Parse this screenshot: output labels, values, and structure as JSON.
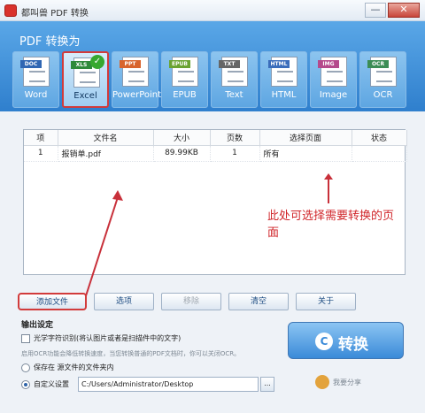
{
  "window": {
    "title": "都叫兽 PDF 转换",
    "minimize": "—",
    "close": "✕"
  },
  "banner": {
    "title": "PDF 转换为"
  },
  "formats": [
    {
      "label": "Word",
      "tag": "DOC",
      "color": "#2f66b3",
      "active": false
    },
    {
      "label": "Excel",
      "tag": "XLS",
      "color": "#2e8a3a",
      "active": true
    },
    {
      "label": "PowerPoint",
      "tag": "PPT",
      "color": "#d8642d",
      "active": false
    },
    {
      "label": "EPUB",
      "tag": "EPUB",
      "color": "#6aa332",
      "active": false
    },
    {
      "label": "Text",
      "tag": "TXT",
      "color": "#666666",
      "active": false
    },
    {
      "label": "HTML",
      "tag": "HTML",
      "color": "#3b6dbb",
      "active": false
    },
    {
      "label": "Image",
      "tag": "IMG",
      "color": "#b54a8c",
      "active": false
    },
    {
      "label": "OCR",
      "tag": "OCR",
      "color": "#3c8d55",
      "active": false
    }
  ],
  "table": {
    "headers": [
      "项",
      "文件名",
      "大小",
      "页数",
      "选择页面",
      "状态"
    ],
    "rows": [
      {
        "index": "1",
        "filename": "报销单.pdf",
        "size": "89.99KB",
        "pages": "1",
        "selected_pages": "所有",
        "status": ""
      }
    ]
  },
  "annotation": {
    "text": "此处可选择需要转换的页面",
    "color": "#d0262a"
  },
  "buttons": {
    "add_file": "添加文件",
    "options": "选项",
    "remove": "移除",
    "clear": "清空",
    "about": "关于"
  },
  "output": {
    "section_title": "输出设定",
    "ocr_label": "光学字符识别(将认图片或者是扫描件中的文字)",
    "ocr_hint": "启用OCR功能会降低转换速度，当您转换普通的PDF文档时，你可以关闭OCR。",
    "save_source": "保存在 源文件的文件夹内",
    "custom": "自定义设置",
    "custom_path": "C:/Users/Administrator/Desktop",
    "browse": "..."
  },
  "convert": {
    "label": "转换"
  },
  "share": {
    "label": "我要分享"
  }
}
